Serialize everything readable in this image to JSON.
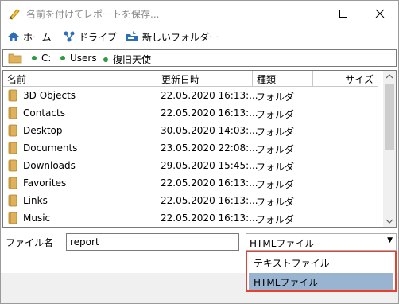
{
  "window": {
    "title": "名前を付けてレポートを保存..."
  },
  "toolbar": {
    "home_label": "ホーム",
    "drive_label": "ドライブ",
    "newfolder_label": "新しいフォルダー"
  },
  "breadcrumb": {
    "segments": [
      "C:",
      "Users",
      "復旧天使"
    ]
  },
  "filelist": {
    "columns": [
      "名前",
      "更新日時",
      "種類",
      "サイズ"
    ],
    "rows": [
      {
        "name": "3D Objects",
        "date": "22.05.2020 16:13:...",
        "type": "フォルダ"
      },
      {
        "name": "Contacts",
        "date": "22.05.2020 16:13:...",
        "type": "フォルダ"
      },
      {
        "name": "Desktop",
        "date": "30.05.2020 14:03:...",
        "type": "フォルダ"
      },
      {
        "name": "Documents",
        "date": "23.05.2020 22:08:...",
        "type": "フォルダ"
      },
      {
        "name": "Downloads",
        "date": "29.05.2020 15:45:...",
        "type": "フォルダ"
      },
      {
        "name": "Favorites",
        "date": "22.05.2020 16:13:...",
        "type": "フォルダ"
      },
      {
        "name": "Links",
        "date": "22.05.2020 16:13:...",
        "type": "フォルダ"
      },
      {
        "name": "Music",
        "date": "22.05.2020 16:13:...",
        "type": "フォルダ"
      }
    ]
  },
  "save": {
    "filename_label": "ファイル名",
    "filename_value": "report",
    "filetype_selected": "HTMLファイル",
    "filetype_options": [
      "テキストファイル",
      "HTMLファイル"
    ]
  },
  "colors": {
    "folder": "#dfb15a",
    "highlight": "#99b4d1",
    "callout": "#e8402a",
    "breadcrumb_dot": "#2e9a42"
  }
}
